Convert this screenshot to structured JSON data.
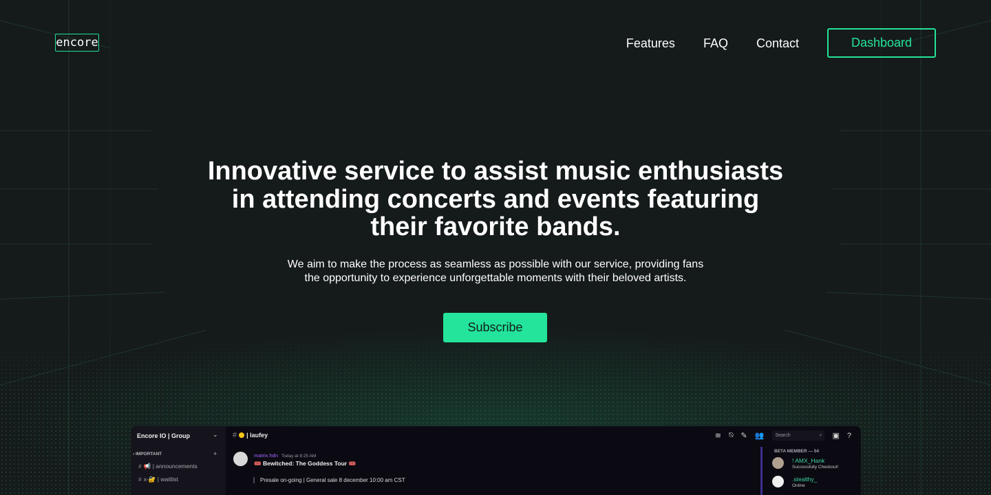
{
  "brand": {
    "logo_text": "encore"
  },
  "nav": {
    "links": [
      "Features",
      "FAQ",
      "Contact"
    ],
    "dashboard_label": "Dashboard"
  },
  "hero": {
    "title_lines": [
      "Innovative service to assist music enthusiasts",
      "in attending concerts and events featuring",
      "their favorite bands."
    ],
    "subtitle_lines": [
      "We aim to make the process as seamless as possible with our service, providing fans",
      "the opportunity to experience unforgettable moments with their beloved artists."
    ],
    "cta_label": "Subscribe"
  },
  "preview": {
    "server_name": "Encore IO | Group",
    "category": "IMPORTANT",
    "channels": [
      {
        "icon": "megaphone-icon",
        "label": "| announcements"
      },
      {
        "icon": "lock-icon",
        "prefix": "x-",
        "label": "| waitlist"
      }
    ],
    "current_channel": "| laufey",
    "search_placeholder": "Search",
    "message": {
      "author": "matrix.hdn",
      "time": "Today at 8:25 AM",
      "title": "Bewitched: The Goddess Tour",
      "body": "Presale on-going  | General sale 8 december 10:00 am CST"
    },
    "members_header": "BETA MEMBER — 54",
    "members": [
      {
        "name": "! AMX_Hank",
        "status": "Successfully Checkout!",
        "color": "#3fd6a0"
      },
      {
        "name": ".stealthy_",
        "status": "Online",
        "color": "#3fd6a0"
      }
    ]
  },
  "colors": {
    "accent": "#23e49a",
    "background": "#151a1a",
    "purple": "#a066ff"
  }
}
